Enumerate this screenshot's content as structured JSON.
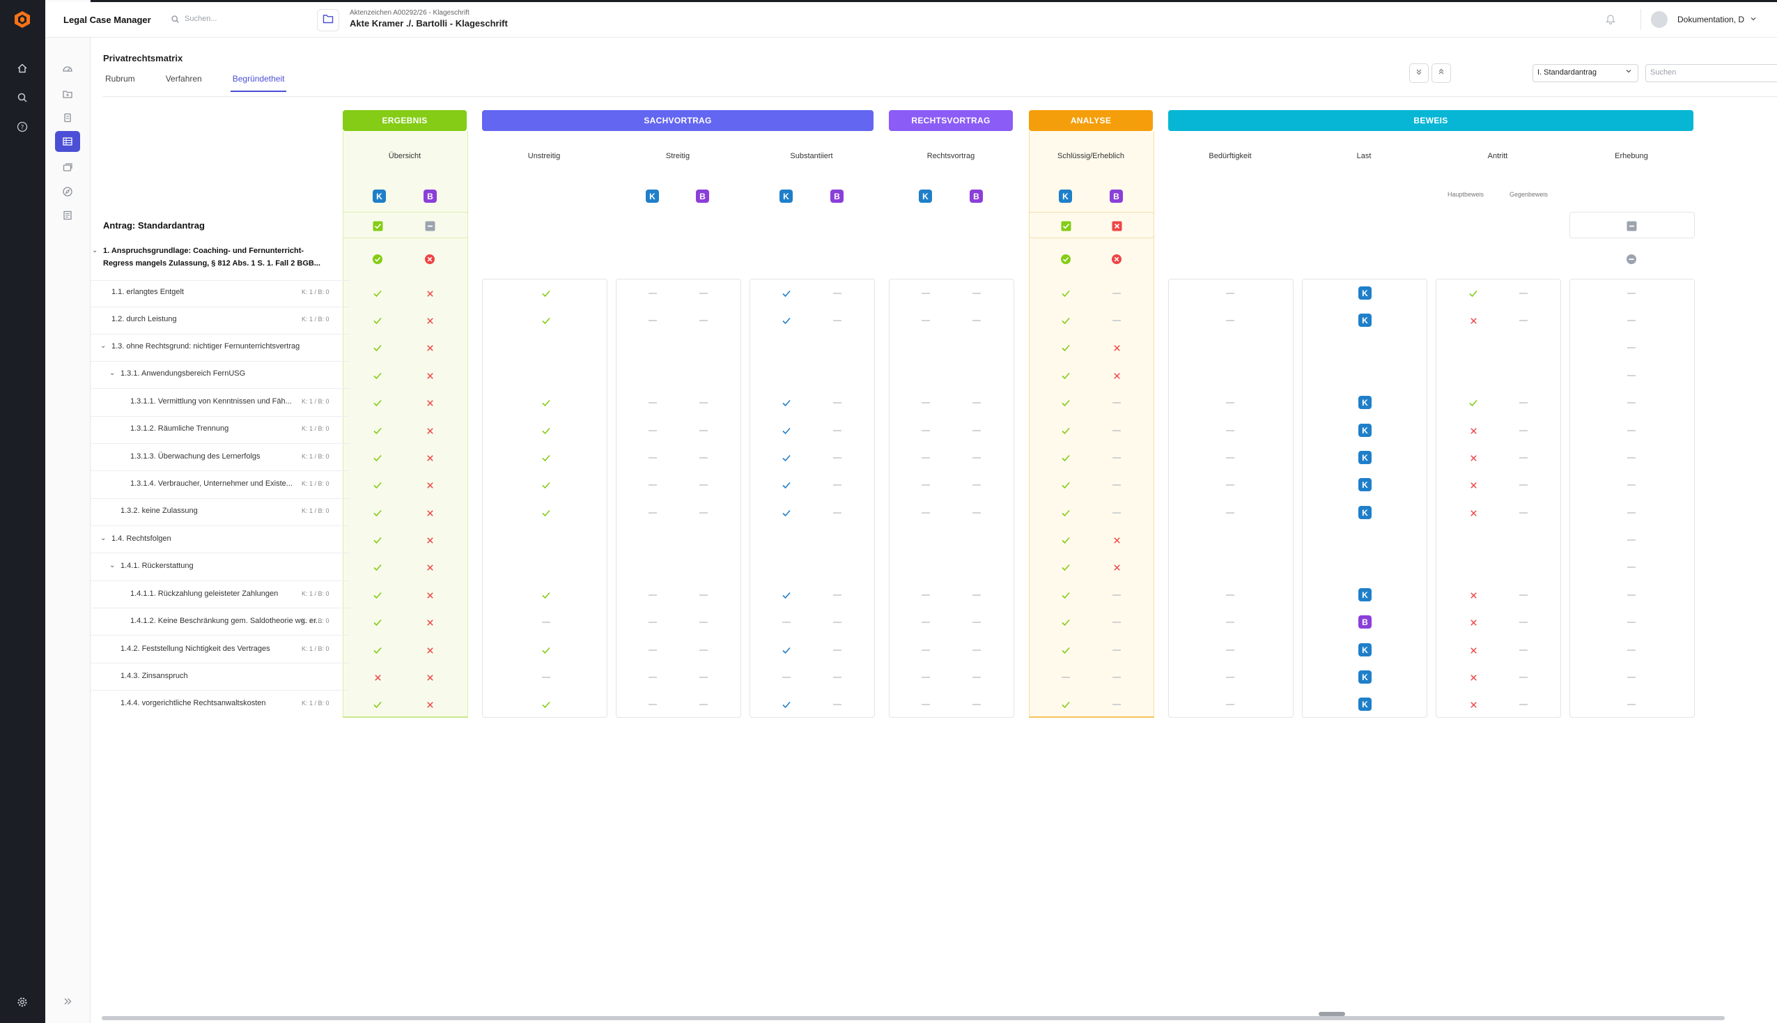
{
  "app": {
    "title": "Legal Case Manager",
    "search_placeholder": "Suchen...",
    "case_reference": "Aktenzeichen A00292/26 - Klageschrift",
    "case_title": "Akte Kramer ./. Bartolli - Klageschrift",
    "user_name": "Dokumentation, D"
  },
  "page": {
    "title": "Privatrechtsmatrix",
    "tabs": [
      "Rubrum",
      "Verfahren",
      "Begründetheit"
    ],
    "active_tab": "Begründetheit",
    "select_value": "I. Standardantrag",
    "search_placeholder": "Suchen"
  },
  "groups": [
    {
      "label": "ERGEBNIS",
      "color": "#84cc16"
    },
    {
      "label": "SACHVORTRAG",
      "color": "#6366f1"
    },
    {
      "label": "RECHTSVORTRAG",
      "color": "#8b5cf6"
    },
    {
      "label": "ANALYSE",
      "color": "#f59e0b"
    },
    {
      "label": "BEWEIS",
      "color": "#06b6d4"
    }
  ],
  "subheaders": [
    "Übersicht",
    "Unstreitig",
    "Streitig",
    "Substantiiert",
    "Rechtsvortrag",
    "Schlüssig/Erheblich",
    "Bedürftigkeit",
    "Last",
    "Antritt",
    "Erhebung"
  ],
  "party_badges": {
    "k": "K",
    "b": "B"
  },
  "antritt_sublabels": [
    "Hauptbeweis",
    "Gegenbeweis"
  ],
  "antrag": {
    "label": "Antrag: Standardantrag"
  },
  "rows": [
    {
      "label": "1. Anspruchsgrundlage: Coaching- und Fernunterricht-Regress mangels Zulassung, § 812 Abs. 1 S. 1. Fall 2 BGB...",
      "line1": "1. Anspruchsgrundlage: Coaching- und Fernunterricht-",
      "line2": "Regress mangels Zulassung, § 812 Abs. 1 S. 1. Fall 2 BGB...",
      "meta": ""
    },
    {
      "label": "1.1. erlangtes Entgelt",
      "meta": "K: 1 / B: 0"
    },
    {
      "label": "1.2. durch Leistung",
      "meta": "K: 1 / B: 0"
    },
    {
      "label": "1.3. ohne Rechtsgrund: nichtiger Fernunterrichtsvertrag",
      "meta": ""
    },
    {
      "label": "1.3.1. Anwendungsbereich FernUSG",
      "meta": ""
    },
    {
      "label": "1.3.1.1. Vermittlung von Kenntnissen und Fäh...",
      "meta": "K: 1 / B: 0"
    },
    {
      "label": "1.3.1.2. Räumliche Trennung",
      "meta": "K: 1 / B: 0"
    },
    {
      "label": "1.3.1.3. Überwachung des Lernerfolgs",
      "meta": "K: 1 / B: 0"
    },
    {
      "label": "1.3.1.4. Verbraucher, Unternehmer und Existe...",
      "meta": "K: 1 / B: 0"
    },
    {
      "label": "1.3.2. keine Zulassung",
      "meta": "K: 1 / B: 0"
    },
    {
      "label": "1.4. Rechtsfolgen",
      "meta": ""
    },
    {
      "label": "1.4.1. Rückerstattung",
      "meta": ""
    },
    {
      "label": "1.4.1.1. Rückzahlung geleisteter Zahlungen",
      "meta": "K: 1 / B: 0"
    },
    {
      "label": "1.4.1.2. Keine Beschränkung gem. Saldotheorie wg. er...",
      "meta": "K: 1 / B: 0"
    },
    {
      "label": "1.4.2. Feststellung Nichtigkeit des Vertrages",
      "meta": "K: 1 / B: 0"
    },
    {
      "label": "1.4.3. Zinsanspruch",
      "meta": ""
    },
    {
      "label": "1.4.4. vorgerichtliche Rechtsanwaltskosten",
      "meta": "K: 1 / B: 0"
    }
  ],
  "status_colors": {
    "check": "#84cc16",
    "blue_check": "#1f7fc9",
    "cross": "#ef4444",
    "dash": "#b8bcc3",
    "neutral": "#9ca3af"
  }
}
